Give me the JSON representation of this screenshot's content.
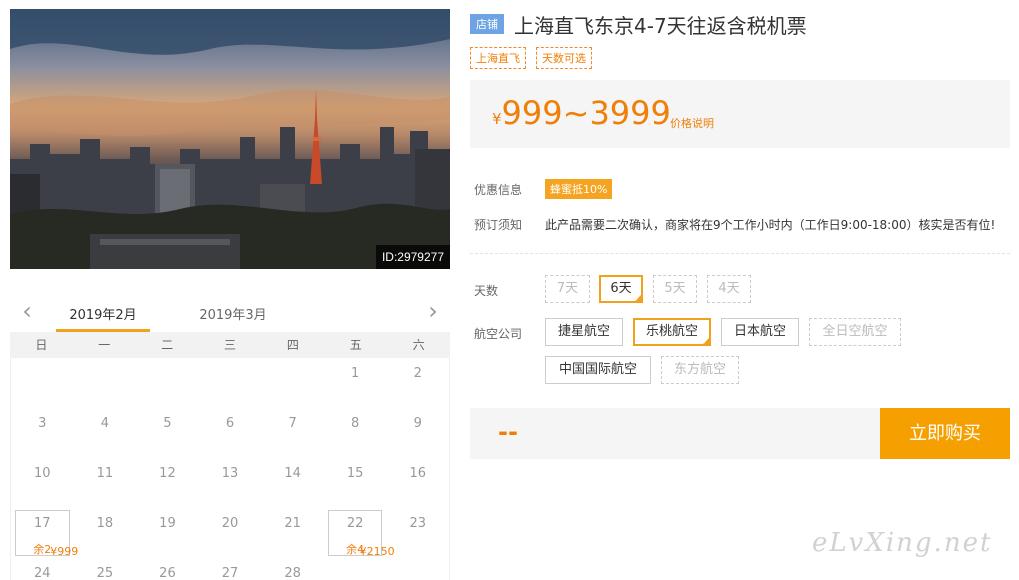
{
  "product": {
    "shop_badge": "店铺",
    "title": "上海直飞东京4-7天往返含税机票",
    "tags": [
      "上海直飞",
      "天数可选"
    ],
    "price_currency": "¥",
    "price_range": "999~3999",
    "price_note": "价格说明",
    "image_id": "ID:2979277"
  },
  "info": {
    "discount_label": "优惠信息",
    "discount_badge": "蜂蜜抵10%",
    "notice_label": "预订须知",
    "notice_text": "此产品需要二次确认，商家将在9个工作小时内（工作日9:00-18:00）核实是否有位!"
  },
  "days": {
    "label": "天数",
    "options": [
      {
        "label": "7天",
        "state": "disabled"
      },
      {
        "label": "6天",
        "state": "selected"
      },
      {
        "label": "5天",
        "state": "disabled"
      },
      {
        "label": "4天",
        "state": "disabled"
      }
    ]
  },
  "airlines": {
    "label": "航空公司",
    "options": [
      {
        "label": "捷星航空",
        "state": "normal"
      },
      {
        "label": "乐桃航空",
        "state": "selected"
      },
      {
        "label": "日本航空",
        "state": "normal"
      },
      {
        "label": "全日空航空",
        "state": "disabled"
      },
      {
        "label": "中国国际航空",
        "state": "normal"
      },
      {
        "label": "东方航空",
        "state": "disabled"
      }
    ]
  },
  "buy": {
    "total": "--",
    "button_label": "立即购买"
  },
  "calendar": {
    "tabs": [
      "2019年2月",
      "2019年3月"
    ],
    "weekdays": [
      "日",
      "一",
      "二",
      "三",
      "四",
      "五",
      "六"
    ],
    "rows": [
      [
        {
          "d": ""
        },
        {
          "d": ""
        },
        {
          "d": ""
        },
        {
          "d": ""
        },
        {
          "d": ""
        },
        {
          "d": "1"
        },
        {
          "d": "2"
        }
      ],
      [
        {
          "d": "3"
        },
        {
          "d": "4"
        },
        {
          "d": "5"
        },
        {
          "d": "6"
        },
        {
          "d": "7"
        },
        {
          "d": "8"
        },
        {
          "d": "9"
        }
      ],
      [
        {
          "d": "10"
        },
        {
          "d": "11"
        },
        {
          "d": "12"
        },
        {
          "d": "13"
        },
        {
          "d": "14"
        },
        {
          "d": "15"
        },
        {
          "d": "16"
        }
      ],
      [
        {
          "d": "17",
          "price": "¥999",
          "stock": "余2"
        },
        {
          "d": "18"
        },
        {
          "d": "19"
        },
        {
          "d": "20"
        },
        {
          "d": "21"
        },
        {
          "d": "22",
          "price": "¥2150",
          "stock": "余4"
        },
        {
          "d": "23"
        }
      ],
      [
        {
          "d": "24"
        },
        {
          "d": "25"
        },
        {
          "d": "26"
        },
        {
          "d": "27"
        },
        {
          "d": "28"
        },
        {
          "d": ""
        },
        {
          "d": ""
        }
      ]
    ]
  },
  "watermark": "eLvXing.net",
  "colors": {
    "accent": "#f5a000",
    "price": "#f07f0a",
    "badge_blue": "#6ea4e6"
  }
}
